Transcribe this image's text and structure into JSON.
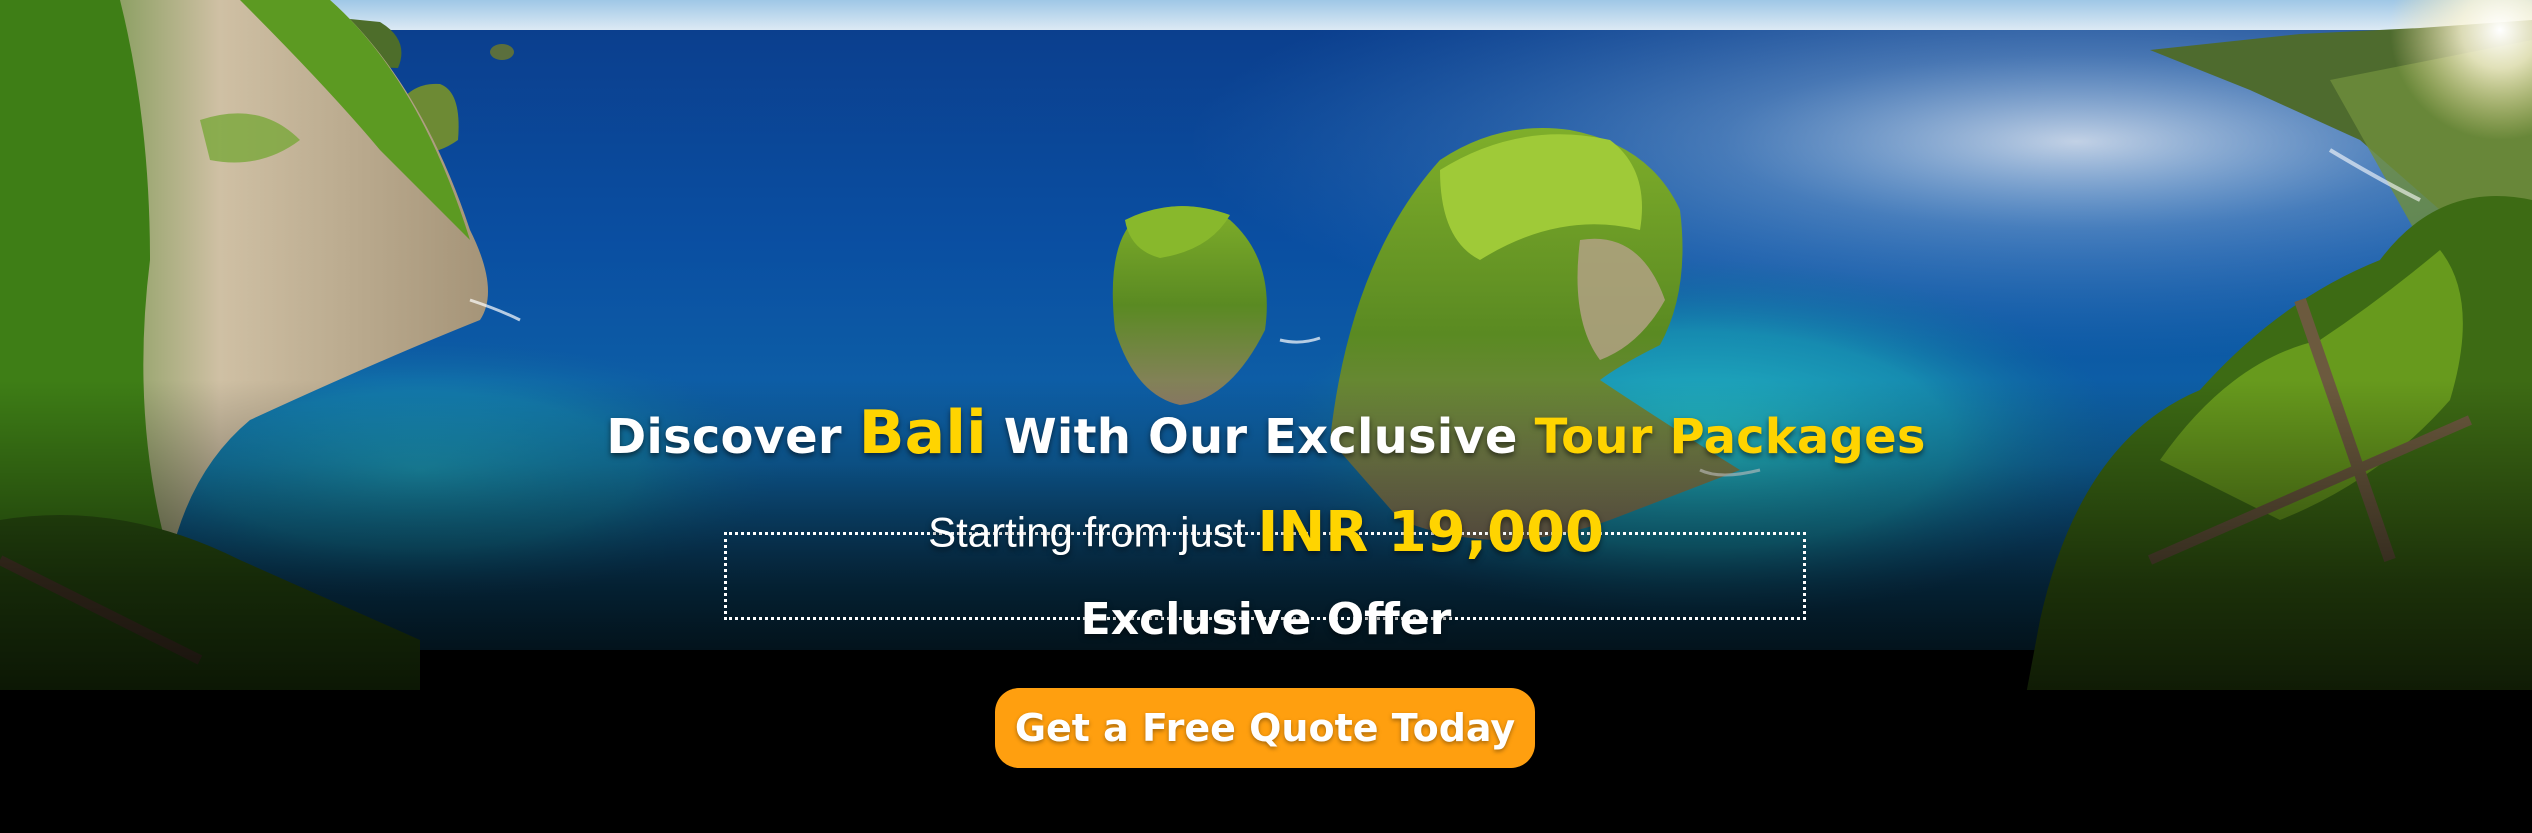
{
  "hero": {
    "headline": {
      "part1": "Discover ",
      "highlight1": "Bali",
      "part2": " With Our Exclusive ",
      "highlight2": "Tour Packages"
    },
    "price": {
      "lead": "Starting from just",
      "value": "INR 19,000"
    },
    "offer_label": "Exclusive Offer",
    "cta_label": "Get a Free Quote Today"
  },
  "colors": {
    "accent_yellow": "#ffd400",
    "cta_orange": "#ff9f0f",
    "text_white": "#ffffff"
  }
}
